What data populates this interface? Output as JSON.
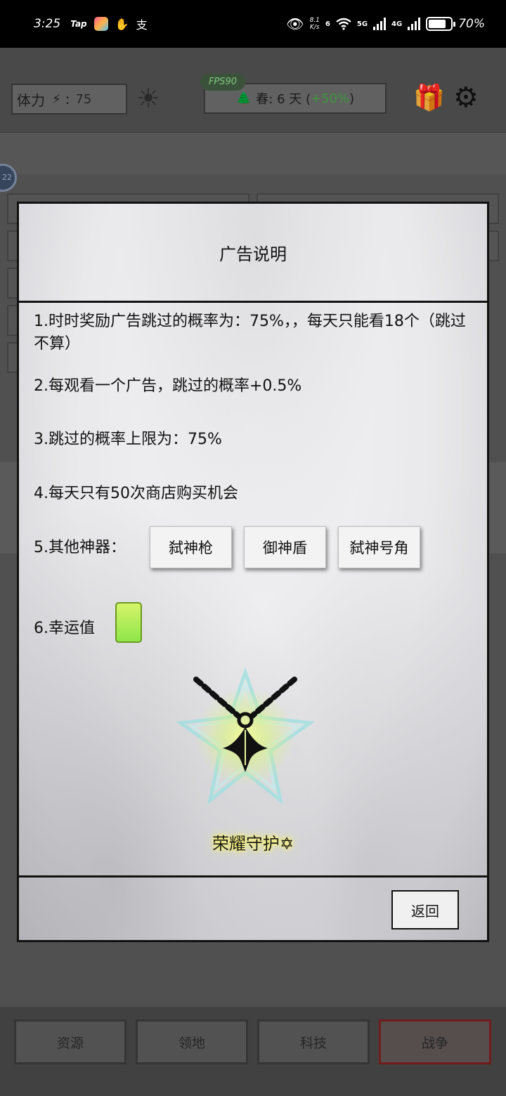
{
  "status_bar": {
    "time": "3:25",
    "tap_label": "Tap",
    "net_speed_value": "8.1",
    "net_speed_unit": "K/s",
    "wifi_label": "6",
    "sim1_label": "5G",
    "sim2_label": "4G",
    "battery_percent": "70%",
    "battery_level": 0.7,
    "icons": [
      "tap-app-icon",
      "colorful-app-icon",
      "hand-icon",
      "alipay-icon",
      "eye-icon",
      "wifi-icon",
      "signal-icon",
      "battery-icon"
    ]
  },
  "top_bar": {
    "stamina_label": "体力",
    "stamina_sep": ":",
    "stamina_value": "75",
    "fps_label": "FPS90",
    "season_text": "春: 6 天 (",
    "season_bonus": "+50%",
    "season_close": ")"
  },
  "side_badge": "22",
  "dialog": {
    "title": "广告说明",
    "rules": [
      "1.时时奖励广告跳过的概率为：75%，，每天只能看18个（跳过不算）",
      "2.每观看一个广告，跳过的概率+0.5%",
      "3.跳过的概率上限为：75%",
      "4.每天只有50次商店购买机会",
      "5.其他神器：",
      "6.幸运值"
    ],
    "artifacts": [
      "弑神枪",
      "御神盾",
      "弑神号角"
    ],
    "honor_text": "荣耀守护",
    "honor_symbol": "✡",
    "back_label": "返回"
  },
  "bottom_nav": {
    "items": [
      "资源",
      "领地",
      "科技",
      "战争"
    ],
    "active": "战争"
  },
  "colors": {
    "accent_green": "#3fa43f",
    "luck_fill": "#b6ee5a",
    "honor_glow": "#f7f050",
    "war_border": "#7a1f1f"
  }
}
